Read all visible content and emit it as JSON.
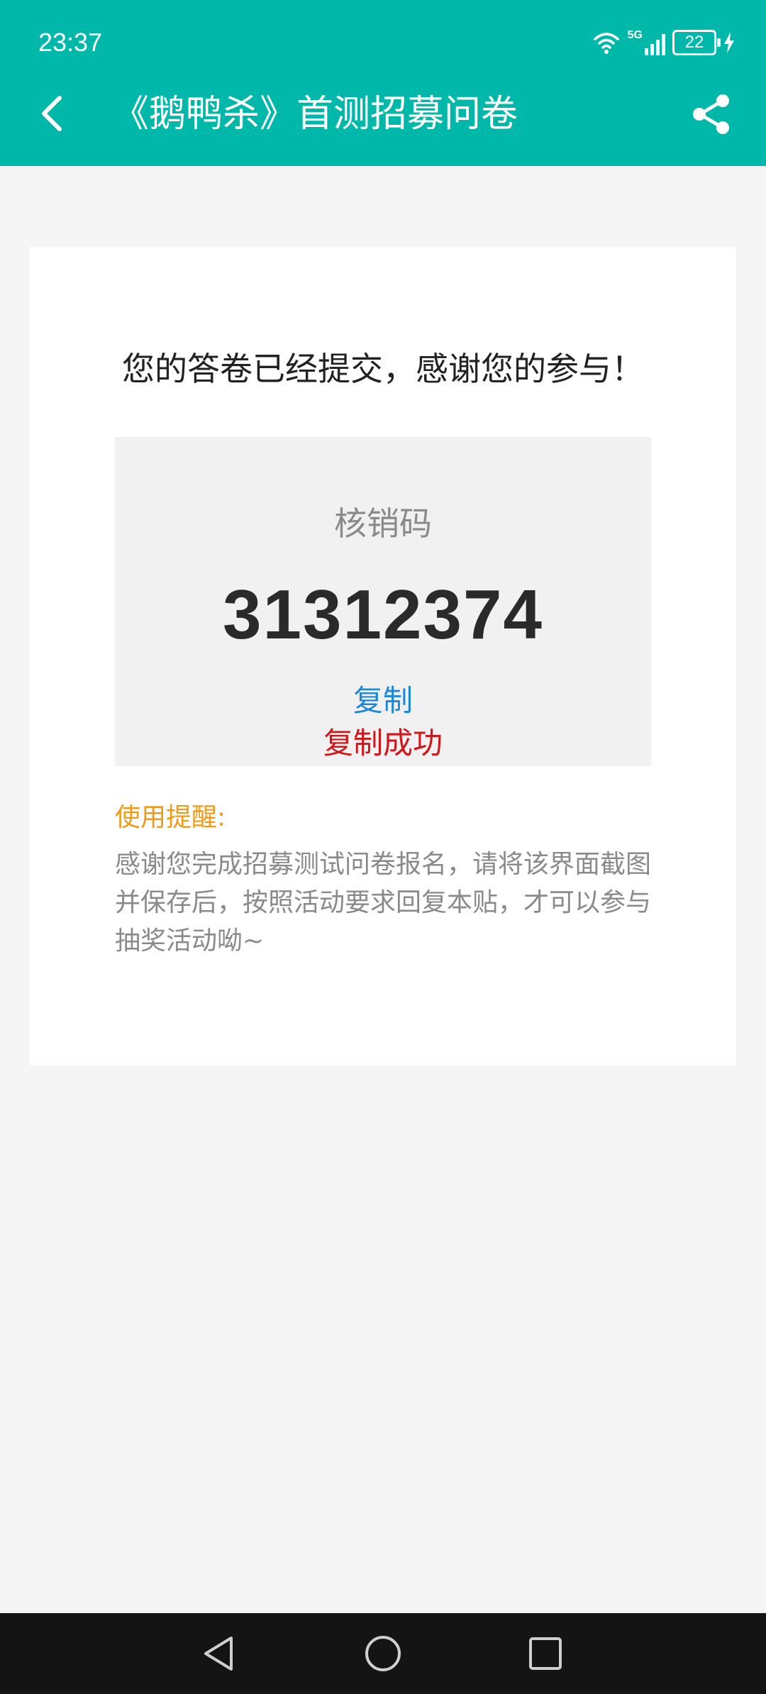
{
  "status_bar": {
    "time": "23:37",
    "network": "5G",
    "battery": "22",
    "icons": [
      "wifi-icon",
      "signal-5g-icon",
      "battery-icon",
      "charging-icon"
    ]
  },
  "header": {
    "title": "《鹅鸭杀》首测招募问卷",
    "back_icon": "back-arrow-icon",
    "share_icon": "share-icon"
  },
  "card": {
    "message": "您的答卷已经提交，感谢您的参与！",
    "code_label": "核销码",
    "code_value": "31312374",
    "copy_label": "复制",
    "copy_success": "复制成功",
    "tip_title": "使用提醒:",
    "tip_body": "感谢您完成招募测试问卷报名，请将该界面截图并保存后，按照活动要求回复本贴，才可以参与抽奖活动呦~"
  },
  "nav_bar": {
    "icons": [
      "back-triangle-icon",
      "home-circle-icon",
      "recents-square-icon"
    ]
  },
  "colors": {
    "header_bg": "#00b8a9",
    "link_blue": "#1e88d6",
    "success_red": "#d0161b",
    "tip_orange": "#ef9b16"
  }
}
